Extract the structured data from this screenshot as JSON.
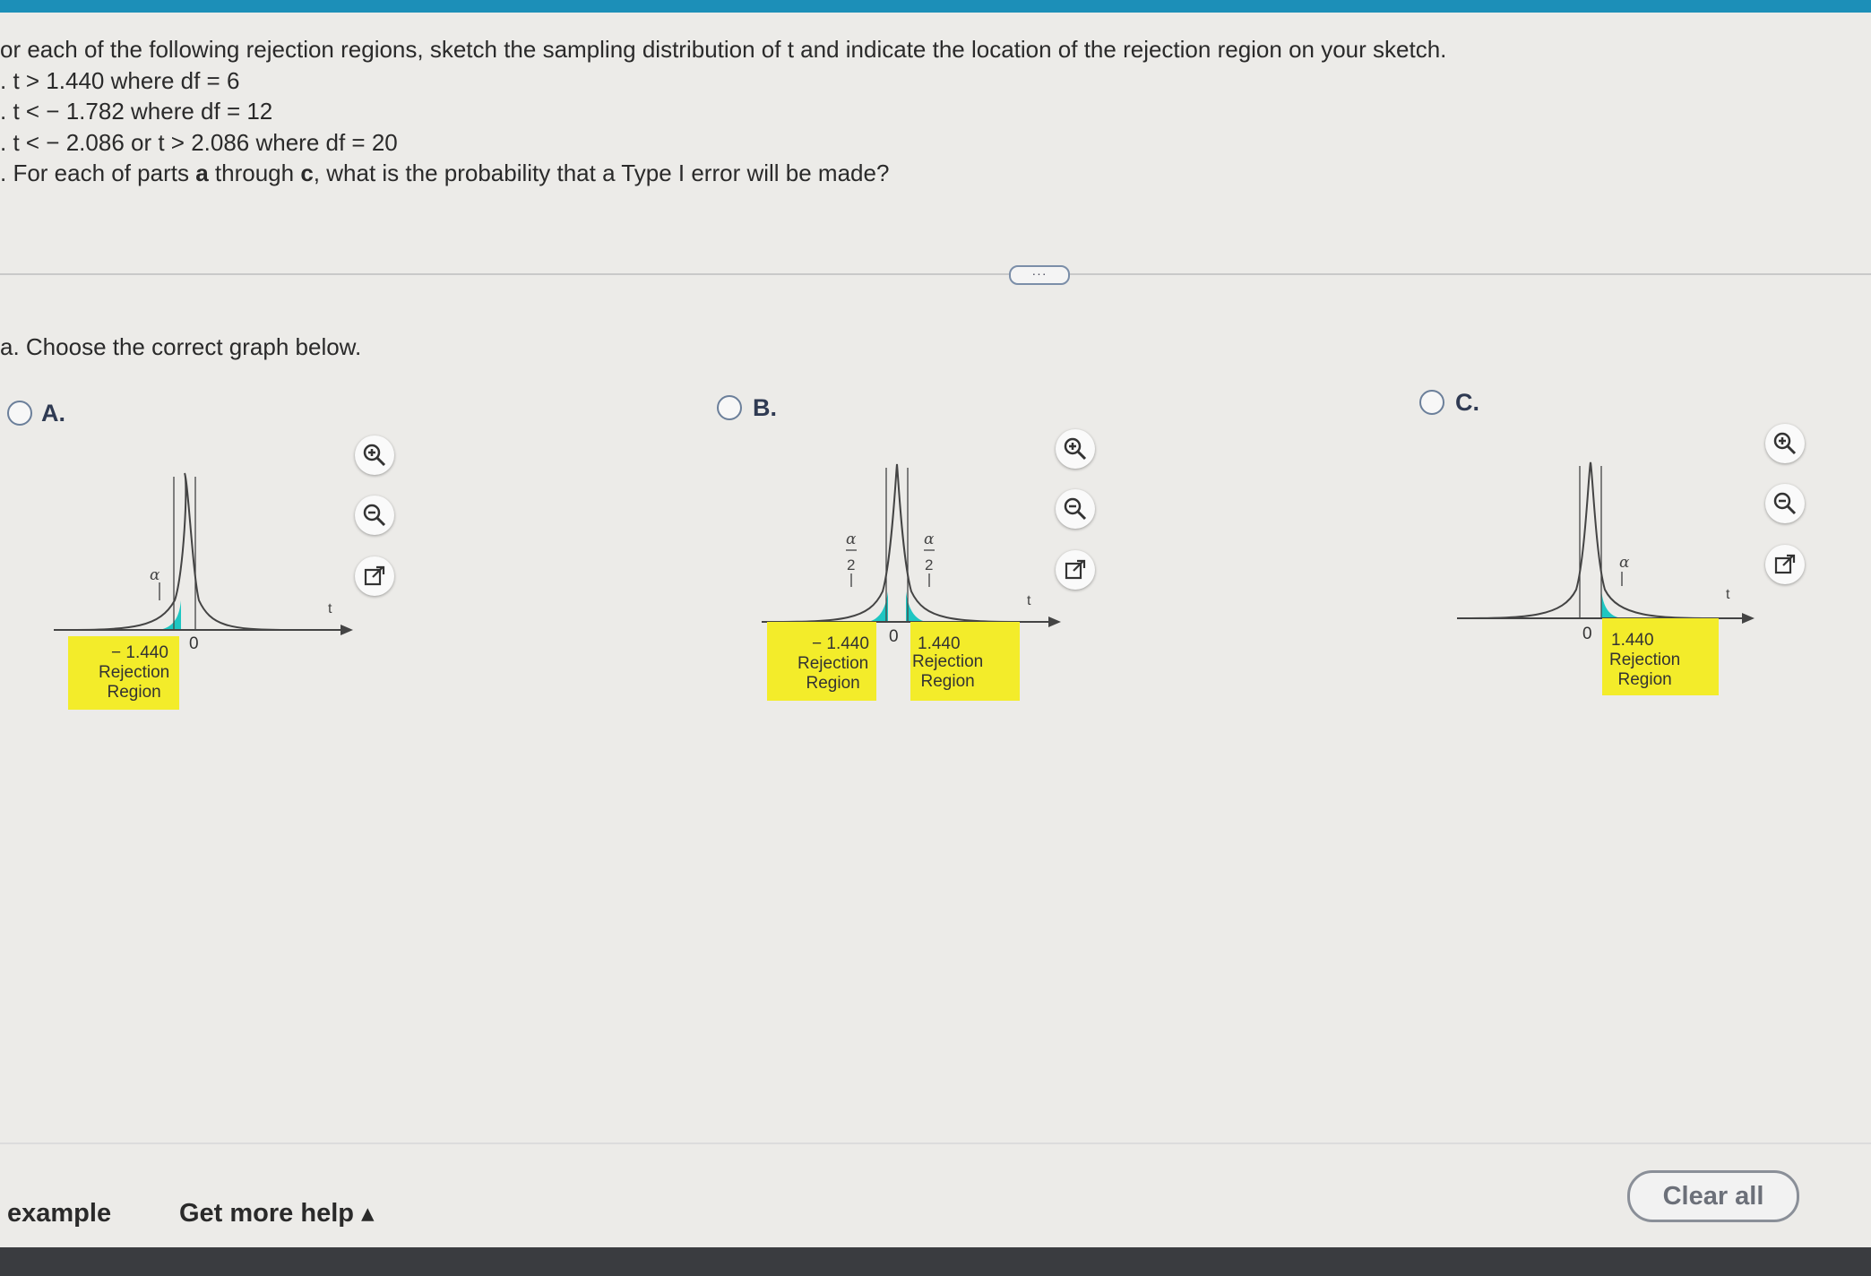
{
  "question": {
    "intro": "or each of the following rejection regions, sketch the sampling distribution of t and indicate the location of the rejection region on your sketch.",
    "part_a": ". t > 1.440 where df = 6",
    "part_b": ". t < − 1.782 where df = 12",
    "part_c": ". t < − 2.086 or t > 2.086 where df = 20",
    "part_d_pre": ". For each of parts ",
    "part_d_a": "a",
    "part_d_mid": " through ",
    "part_d_c": "c",
    "part_d_post": ", what is the probability that a Type I error will be made?"
  },
  "more_button": "···",
  "subquestion": "a. Choose the correct graph below.",
  "options": [
    {
      "letter": "A.",
      "alpha": "α",
      "axis": "t",
      "zero": "0",
      "crit": "− 1.440",
      "region": [
        "Rejection",
        "Region"
      ]
    },
    {
      "letter": "B.",
      "alpha": "α",
      "alpha_den": "2",
      "axis": "t",
      "zero": "0",
      "crit_left": "− 1.440",
      "crit_right": "1.440",
      "region_left": [
        "Rejection",
        "Region"
      ],
      "region_right": [
        "Rejection",
        "Region"
      ]
    },
    {
      "letter": "C.",
      "alpha": "α",
      "axis": "t",
      "zero": "0",
      "crit": "1.440",
      "region": [
        "Rejection",
        "Region"
      ]
    }
  ],
  "icons": [
    "zoom-in-icon",
    "zoom-out-icon",
    "pop-out-icon",
    "radio-icon"
  ],
  "colors": {
    "tail": "#1ec6c2",
    "rejection_region": "#f3ec2a",
    "top_bar": "#1c8fb8"
  },
  "footer": {
    "example": "example",
    "more_help": "Get more help ▴",
    "clear_all": "Clear all"
  }
}
